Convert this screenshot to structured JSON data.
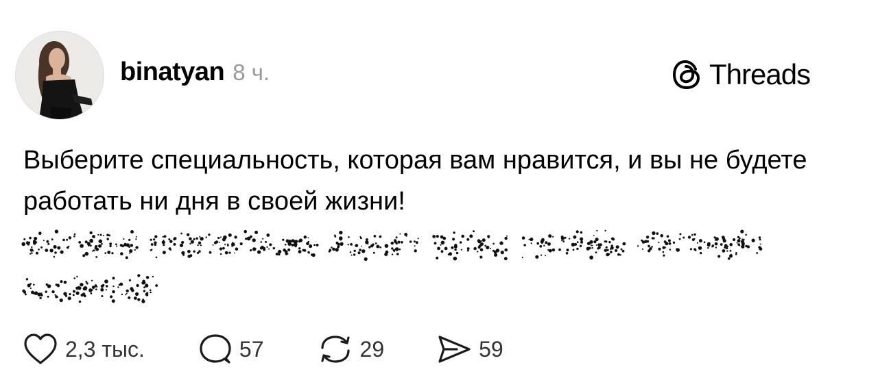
{
  "post": {
    "username": "binatyan",
    "time": "8 ч.",
    "brand": {
      "name": "Threads",
      "icon": "threads-logo-icon"
    },
    "text": "Выберите специальность, которая вам нравится, и вы не будете работать ни дня в своей жизни!",
    "spoiler_hidden": true
  },
  "actions": {
    "like": {
      "icon": "heart-icon",
      "count": "2,3 тыс."
    },
    "reply": {
      "icon": "comment-icon",
      "count": "57"
    },
    "repost": {
      "icon": "repost-icon",
      "count": "29"
    },
    "share": {
      "icon": "send-icon",
      "count": "59"
    }
  }
}
